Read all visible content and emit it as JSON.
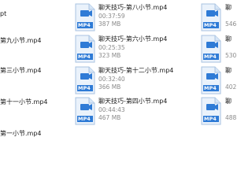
{
  "left_column": [
    {
      "name": "pt"
    },
    {
      "name": "第九小节.mp4"
    },
    {
      "name": "第三小节.mp4"
    },
    {
      "name": "第十一小节.mp4"
    },
    {
      "name": "第一小节.mp4"
    }
  ],
  "middle_column": [
    {
      "name": "聊天技巧-第八小节.mp4",
      "duration": "00:37:59",
      "size": "387 MB",
      "badge": "MP4"
    },
    {
      "name": "聊天技巧-第六小节.mp4",
      "duration": "00:25:35",
      "size": "323 MB",
      "badge": "MP4"
    },
    {
      "name": "聊天技巧-第十二小节.mp4",
      "duration": "00:32:40",
      "size": "366 MB",
      "badge": "MP4"
    },
    {
      "name": "聊天技巧-第四小节.mp4",
      "duration": "00:44:43",
      "size": "467 MB",
      "badge": "MP4"
    }
  ],
  "right_column": [
    {
      "name": "聊",
      "size": "546",
      "badge": "MP4"
    },
    {
      "name": "聊",
      "size": "530",
      "badge": "MP4"
    },
    {
      "name": "聊",
      "size": "402",
      "badge": "MP4"
    },
    {
      "name": "聊",
      "size": "488",
      "badge": "MP4"
    }
  ],
  "colors": {
    "icon_body": "#eaf2fb",
    "icon_border": "#a9c3e0",
    "icon_accent": "#2f7bd6",
    "meta_text": "#8a8a8a"
  },
  "icon_kind": "video-file-icon"
}
